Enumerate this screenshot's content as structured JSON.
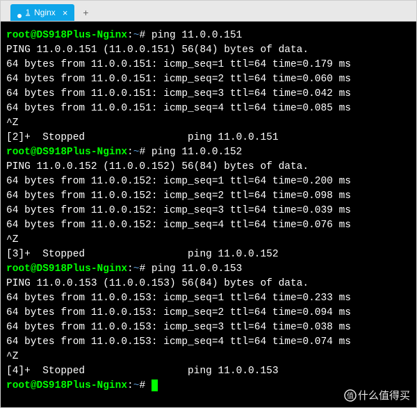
{
  "tab": {
    "number": "1",
    "title": "Nginx",
    "close": "×"
  },
  "newtab": "+",
  "prompt": {
    "user": "root",
    "at": "@",
    "host": "DS918Plus-Nginx",
    "colon": ":",
    "path": "~",
    "symbol": "#"
  },
  "sessions": [
    {
      "cmd": "ping 11.0.0.151",
      "header": "PING 11.0.0.151 (11.0.0.151) 56(84) bytes of data.",
      "lines": [
        "64 bytes from 11.0.0.151: icmp_seq=1 ttl=64 time=0.179 ms",
        "64 bytes from 11.0.0.151: icmp_seq=2 ttl=64 time=0.060 ms",
        "64 bytes from 11.0.0.151: icmp_seq=3 ttl=64 time=0.042 ms",
        "64 bytes from 11.0.0.151: icmp_seq=4 ttl=64 time=0.085 ms"
      ],
      "suspend": "^Z",
      "stopped": "[2]+  Stopped                 ping 11.0.0.151"
    },
    {
      "cmd": "ping 11.0.0.152",
      "header": "PING 11.0.0.152 (11.0.0.152) 56(84) bytes of data.",
      "lines": [
        "64 bytes from 11.0.0.152: icmp_seq=1 ttl=64 time=0.200 ms",
        "64 bytes from 11.0.0.152: icmp_seq=2 ttl=64 time=0.098 ms",
        "64 bytes from 11.0.0.152: icmp_seq=3 ttl=64 time=0.039 ms",
        "64 bytes from 11.0.0.152: icmp_seq=4 ttl=64 time=0.076 ms"
      ],
      "suspend": "^Z",
      "stopped": "[3]+  Stopped                 ping 11.0.0.152"
    },
    {
      "cmd": "ping 11.0.0.153",
      "header": "PING 11.0.0.153 (11.0.0.153) 56(84) bytes of data.",
      "lines": [
        "64 bytes from 11.0.0.153: icmp_seq=1 ttl=64 time=0.233 ms",
        "64 bytes from 11.0.0.153: icmp_seq=2 ttl=64 time=0.094 ms",
        "64 bytes from 11.0.0.153: icmp_seq=3 ttl=64 time=0.038 ms",
        "64 bytes from 11.0.0.153: icmp_seq=4 ttl=64 time=0.074 ms"
      ],
      "suspend": "^Z",
      "stopped": "[4]+  Stopped                 ping 11.0.0.153"
    }
  ],
  "watermark": "什么值得买"
}
